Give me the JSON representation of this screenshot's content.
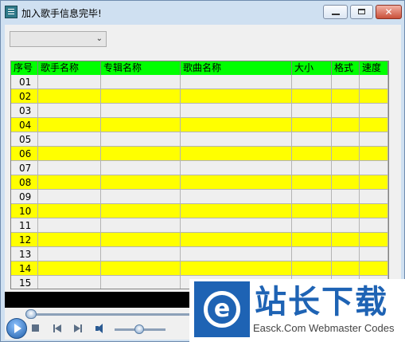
{
  "window": {
    "title": "加入歌手信息完毕!",
    "close_glyph": "✕"
  },
  "filter_select": {
    "value": ""
  },
  "table": {
    "columns": [
      "序号",
      "歌手名称",
      "专辑名称",
      "歌曲名称",
      "大小",
      "格式",
      "速度"
    ],
    "rows": [
      "01",
      "02",
      "03",
      "04",
      "05",
      "06",
      "07",
      "08",
      "09",
      "10",
      "11",
      "12",
      "13",
      "14",
      "15"
    ],
    "odd_row_color": "#efefef",
    "even_row_color": "#ffff00",
    "header_color": "#00ff00"
  },
  "player": {
    "icons": [
      "play-icon",
      "stop-icon",
      "previous-icon",
      "next-icon",
      "volume-icon"
    ]
  },
  "watermark": {
    "badge_letter": "e",
    "name_cn": "站长下载",
    "name_en": "Easck.Com Webmaster Codes"
  }
}
